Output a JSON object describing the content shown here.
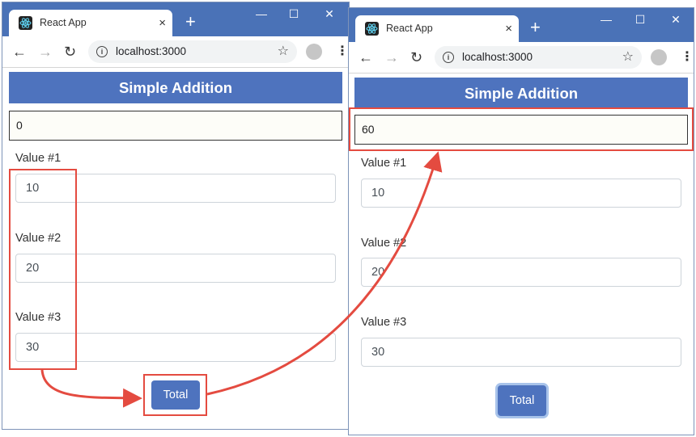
{
  "left_window": {
    "tab_title": "React App",
    "url": "localhost:3000",
    "heading": "Simple Addition",
    "result": "0",
    "fields": [
      {
        "label": "Value #1",
        "value": "10"
      },
      {
        "label": "Value #2",
        "value": "20"
      },
      {
        "label": "Value #3",
        "value": "30"
      }
    ],
    "button_label": "Total"
  },
  "right_window": {
    "tab_title": "React App",
    "url": "localhost:3000",
    "heading": "Simple Addition",
    "result": "60",
    "fields": [
      {
        "label": "Value #1",
        "value": "10"
      },
      {
        "label": "Value #2",
        "value": "20"
      },
      {
        "label": "Value #3",
        "value": "30"
      }
    ],
    "button_label": "Total"
  },
  "icons": {
    "favicon": "react-logo-icon",
    "close": "×",
    "new_tab": "+",
    "minimize": "—",
    "maximize": "☐",
    "window_close": "✕",
    "back": "←",
    "forward": "→",
    "reload": "↻",
    "info": "i",
    "star": "☆",
    "menu": "⋮"
  },
  "colors": {
    "chrome_blue": "#4a72b7",
    "header_blue": "#4e73be",
    "annotation_red": "#e44b40"
  }
}
